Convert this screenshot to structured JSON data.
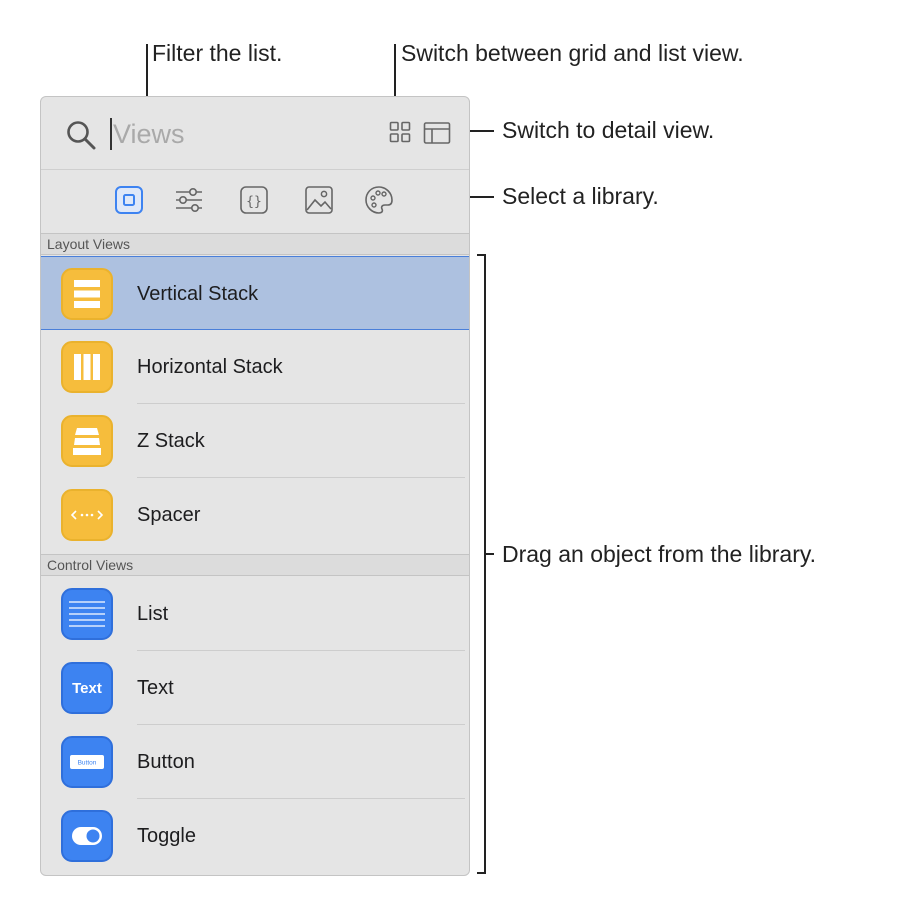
{
  "callouts": {
    "filter": "Filter the list.",
    "grid_list": "Switch between grid and list view.",
    "detail": "Switch to detail view.",
    "library": "Select a library.",
    "drag": "Drag an object from the library."
  },
  "search": {
    "placeholder": "Views",
    "value": ""
  },
  "toolbar": {
    "grid_icon": "grid-view-icon",
    "detail_icon": "detail-view-icon"
  },
  "libraries": [
    {
      "icon": "views-library-icon",
      "selected": true
    },
    {
      "icon": "modifiers-library-icon",
      "selected": false
    },
    {
      "icon": "snippets-library-icon",
      "selected": false
    },
    {
      "icon": "media-library-icon",
      "selected": false
    },
    {
      "icon": "color-library-icon",
      "selected": false
    }
  ],
  "sections": [
    {
      "title": "Layout Views",
      "items": [
        {
          "label": "Vertical Stack",
          "icon": "vertical-stack-icon",
          "color": "#f6bd3c",
          "selected": true
        },
        {
          "label": "Horizontal Stack",
          "icon": "horizontal-stack-icon",
          "color": "#f6bd3c",
          "selected": false
        },
        {
          "label": "Z Stack",
          "icon": "z-stack-icon",
          "color": "#f6bd3c",
          "selected": false
        },
        {
          "label": "Spacer",
          "icon": "spacer-icon",
          "color": "#f6bd3c",
          "selected": false
        }
      ]
    },
    {
      "title": "Control Views",
      "items": [
        {
          "label": "List",
          "icon": "list-icon",
          "color": "#3d83f1",
          "selected": false
        },
        {
          "label": "Text",
          "icon": "text-icon",
          "icon_text": "Text",
          "color": "#3d83f1",
          "selected": false
        },
        {
          "label": "Button",
          "icon": "button-icon",
          "icon_text": "Button",
          "color": "#3d83f1",
          "selected": false
        },
        {
          "label": "Toggle",
          "icon": "toggle-icon",
          "color": "#3d83f1",
          "selected": false
        }
      ]
    }
  ],
  "colors": {
    "selection": "#adc1e0",
    "selection_border": "#4a7fd9",
    "accent_blue": "#3d83f1",
    "accent_yellow": "#f6bd3c",
    "panel_bg": "#e5e5e5"
  }
}
